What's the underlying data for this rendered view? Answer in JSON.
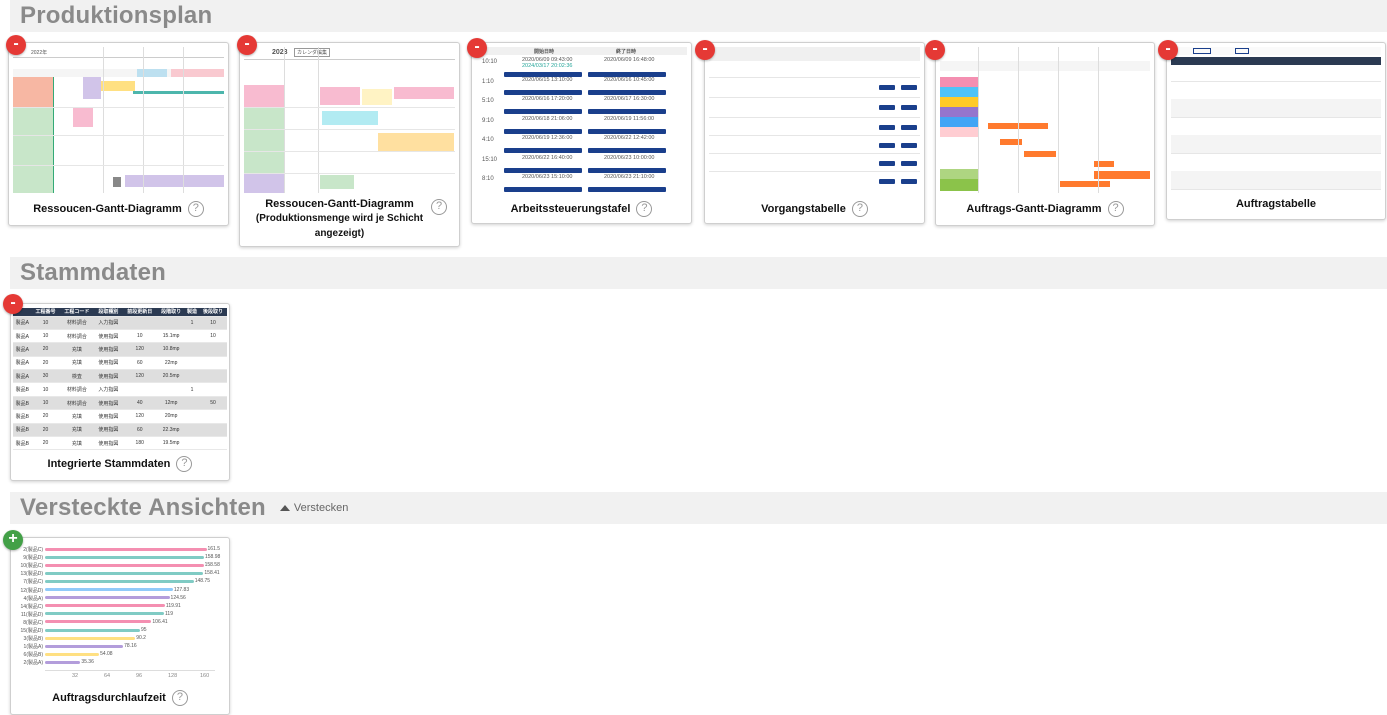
{
  "sections": {
    "produktionsplan": "Produktionsplan",
    "stammdaten": "Stammdaten",
    "versteckte": "Versteckte Ansichten",
    "hide_label": "Verstecken"
  },
  "cards": {
    "c1": "Ressoucen-Gantt-Diagramm",
    "c2_title": "Ressoucen-Gantt-Diagramm",
    "c2_sub": "(Produktionsmenge wird je Schicht angezeigt)",
    "c3": "Arbeitssteuerungstafel",
    "c4": "Vorgangstabelle",
    "c5": "Auftrags-Gantt-Diagramm",
    "c6": "Auftragstabelle",
    "c7": "Integrierte Stammdaten",
    "c8": "Auftragsdurchlaufzeit"
  },
  "icons": {
    "remove": "minus-icon",
    "add": "plus-icon",
    "help": "question-circle-icon",
    "toggle": "caret-up-icon"
  },
  "badge": {
    "remove": "-",
    "add": "+",
    "help": "?"
  },
  "thumb_c1": {
    "year": "2022年"
  },
  "thumb_c2": {
    "year": "2023",
    "dropdown": "カレンダ編集"
  },
  "thumb_c3": {
    "rows": [
      [
        "10:10",
        "2020/06/09 09:43:00",
        "2020/06/09 16:48:00"
      ],
      [
        "1:10",
        "2020/06/15 13:10:00",
        "2020/06/16 10:45:00"
      ],
      [
        "5:10",
        "2020/06/16 17:20:00",
        "2020/06/17 16:30:00"
      ],
      [
        "9:10",
        "2020/06/18 21:06:00",
        "2020/06/19 11:56:00"
      ],
      [
        "4:10",
        "2020/06/19 12:36:00",
        "2020/06/22 12:42:00"
      ],
      [
        "15:10",
        "2020/06/22 16:40:00",
        "2020/06/23 10:00:00"
      ],
      [
        "8:10",
        "2020/06/23 15:10:00",
        "2020/06/23 21:10:00"
      ]
    ],
    "highlight": "2024/03/17 20:02:36",
    "head_start": "開始日時",
    "head_end": "終了日時"
  },
  "thumb_c7": {
    "headers": [
      "工程番号",
      "工程コード",
      "段取種別",
      "前段更新日",
      "段階取り",
      "製造",
      "後段取り"
    ],
    "rows": [
      [
        "製品A",
        "10",
        "材料調合",
        "入力指図",
        "",
        "",
        "1",
        "10"
      ],
      [
        "製品A",
        "10",
        "材料調合",
        "使用指図",
        "10",
        "15.1mp",
        "",
        "10"
      ],
      [
        "製品A",
        "20",
        "充填",
        "使用指図",
        "120",
        "10.8mp",
        "",
        ""
      ],
      [
        "製品A",
        "20",
        "充填",
        "使用指図",
        "60",
        "22mp",
        "",
        ""
      ],
      [
        "製品A",
        "30",
        "検査",
        "使用指図",
        "120",
        "20.5mp",
        "",
        ""
      ],
      [
        "製品B",
        "10",
        "材料調合",
        "入力指図",
        "",
        "",
        "1",
        ""
      ],
      [
        "製品B",
        "10",
        "材料調合",
        "使用指図",
        "40",
        "12mp",
        "",
        "50"
      ],
      [
        "製品B",
        "20",
        "充填",
        "使用指図",
        "120",
        "20mp",
        "",
        ""
      ],
      [
        "製品B",
        "20",
        "充填",
        "使用指図",
        "60",
        "22.3mp",
        "",
        ""
      ],
      [
        "製品B",
        "20",
        "充填",
        "使用指図",
        "180",
        "19.5mp",
        "",
        ""
      ]
    ]
  },
  "chart_data": {
    "type": "bar",
    "orientation": "horizontal",
    "categories": [
      "2(製品C)",
      "9(製品D)",
      "10(製品C)",
      "13(製品D)",
      "7(製品C)",
      "12(製品D)",
      "4(製品A)",
      "14(製品C)",
      "11(製品D)",
      "8(製品C)",
      "15(製品D)",
      "3(製品B)",
      "1(製品A)",
      "6(製品B)",
      "2(製品A)"
    ],
    "values": [
      161.5,
      158.98,
      158.58,
      158.41,
      148.75,
      127.83,
      124.56,
      119.91,
      119,
      106.41,
      95,
      90.2,
      78.16,
      54.08,
      35.36
    ],
    "value_labels": [
      "161.5",
      "158.98",
      "158.58",
      "158.41",
      "148.75",
      "127.83",
      "124.56",
      "119.91",
      "119",
      "106.41",
      "95",
      "90.2",
      "78.16",
      "54.08",
      "35.36"
    ],
    "colors": [
      "#f48fb1",
      "#80cbc4",
      "#f48fb1",
      "#80cbc4",
      "#80cbc4",
      "#90caf9",
      "#b39ddb",
      "#f48fb1",
      "#80cbc4",
      "#f48fb1",
      "#80cbc4",
      "#ffe082",
      "#b39ddb",
      "#ffe082",
      "#b39ddb"
    ],
    "xticks": [
      "32",
      "64",
      "96",
      "128",
      "160"
    ],
    "xlim": [
      0,
      170
    ],
    "title": "",
    "xlabel": "",
    "ylabel": ""
  }
}
